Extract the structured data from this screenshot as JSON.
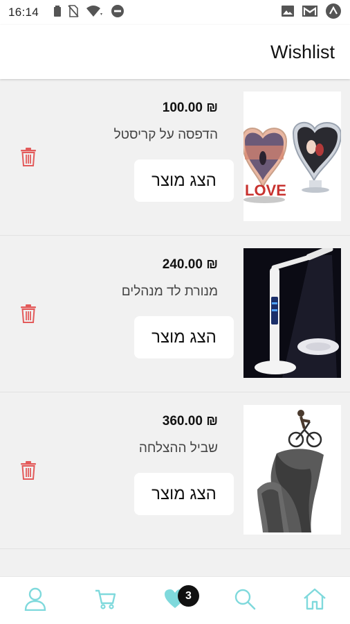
{
  "status_bar": {
    "time": "16:14",
    "icons": [
      "battery-icon",
      "no-sim-icon",
      "wifi-icon",
      "do-not-disturb-icon",
      "image-icon",
      "gmail-icon",
      "notification-icon"
    ]
  },
  "header": {
    "title": "Wishlist"
  },
  "wishlist": {
    "items": [
      {
        "price": "₪ 100.00",
        "name": "הדפסה על קריסטל",
        "button_label": "הצג מוצר",
        "image": "crystal-print-hearts"
      },
      {
        "price": "₪ 240.00",
        "name": "מנורת לד מנהלים",
        "button_label": "הצג מוצר",
        "image": "led-desk-lamp"
      },
      {
        "price": "₪ 360.00",
        "name": "שביל ההצלחה",
        "button_label": "הצג מוצר",
        "image": "cyclist-sculpture"
      }
    ]
  },
  "bottom_nav": {
    "items": [
      "profile-icon",
      "cart-icon",
      "heart-icon",
      "search-icon",
      "home-icon"
    ],
    "wishlist_badge": "3",
    "accent_color": "#7fd9dc"
  },
  "colors": {
    "trash": "#e35a5a",
    "accent": "#7fd9dc",
    "background": "#f1f1f1"
  }
}
